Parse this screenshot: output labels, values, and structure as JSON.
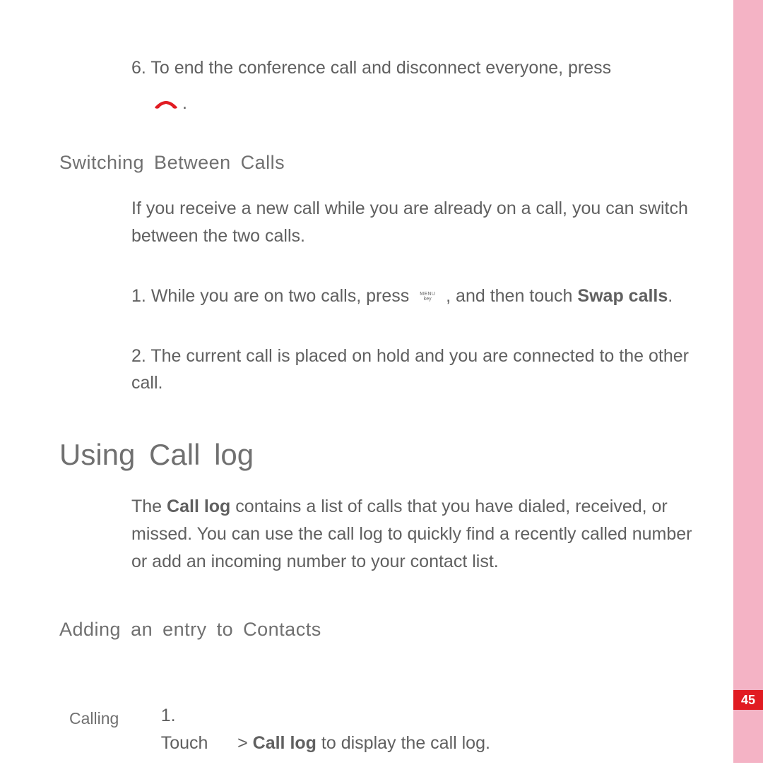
{
  "step6": {
    "num": "6.",
    "text": "To end the conference call and disconnect everyone, press",
    "period": "."
  },
  "switching": {
    "heading": "Switching Between Calls",
    "intro": "If you receive a new call while you are already on a call, you can switch between the two calls.",
    "step1": {
      "num": "1.",
      "pre": "While you are on two calls, press",
      "menu_top": "MENU",
      "menu_bottom": "key",
      "mid": ", and then touch",
      "bold": "Swap calls",
      "post": "."
    },
    "step2": {
      "num": "2.",
      "text": "The current call is placed on hold and you are connected to the other call."
    }
  },
  "calllog": {
    "heading": "Using Call log",
    "intro_pre": "The",
    "intro_bold": "Call log",
    "intro_post": "contains a list of calls that you have dialed, received, or missed. You can use the call log to quickly find a recently called number or add an incoming number to your contact list.",
    "sub_heading": "Adding an entry to Contacts",
    "step1": {
      "num": "1.",
      "pre": "Touch",
      "gap": "      ",
      "arrow": ">",
      "bold": "Call log",
      "post": "to display the call log."
    }
  },
  "footer": "Calling",
  "page_number": "45"
}
